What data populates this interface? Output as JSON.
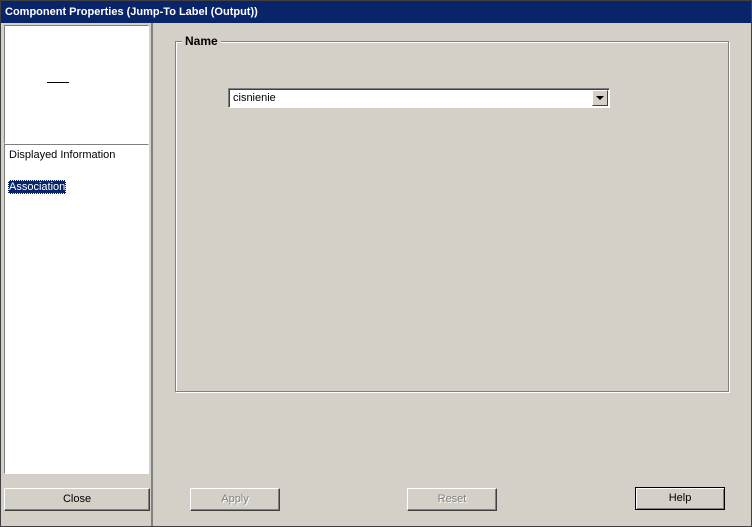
{
  "window": {
    "title": "Component Properties (Jump-To Label (Output))"
  },
  "sidebar": {
    "items": [
      {
        "label": "Displayed Information",
        "selected": false
      },
      {
        "label": "Association",
        "selected": true
      }
    ],
    "close_label": "Close"
  },
  "main": {
    "group_title": "Name",
    "name_select": {
      "value": "cisnienie"
    }
  },
  "footer": {
    "apply_label": "Apply",
    "reset_label": "Reset",
    "help_label": "Help"
  },
  "colors": {
    "titlebar": "#0a246a",
    "face": "#d4d0c8",
    "selection": "#0a246a"
  }
}
